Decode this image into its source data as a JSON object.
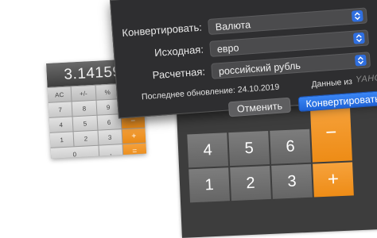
{
  "small_calculator": {
    "display": "3.1415926",
    "keys": [
      "AC",
      "+/-",
      "%",
      "÷",
      "7",
      "8",
      "9",
      "×",
      "4",
      "5",
      "6",
      "−",
      "1",
      "2",
      "3",
      "+",
      "0",
      "",
      ",",
      "="
    ],
    "key_types": [
      "fn",
      "fn",
      "fn",
      "op",
      "num",
      "num",
      "num",
      "op",
      "num",
      "num",
      "num",
      "op",
      "num",
      "num",
      "num",
      "op",
      "num",
      "num",
      "num",
      "op"
    ]
  },
  "big_calculator": {
    "keys": [
      "4",
      "5",
      "6",
      "−",
      "1",
      "2",
      "3",
      "+"
    ]
  },
  "dialog": {
    "convert_label": "Конвертировать:",
    "convert_value": "Валюта",
    "source_label": "Исходная:",
    "source_value": "евро",
    "target_label": "Расчетная:",
    "target_value": "российский рубль",
    "last_update": "Последнее обновление: 24.10.2019",
    "data_from": "Данные из",
    "provider": "YAHOO!",
    "cancel_label": "Отменить",
    "convert_button_label": "Конвертировать"
  },
  "colors": {
    "dialog_bg": "#2e2e30",
    "accent_blue": "#2f6fe0",
    "operator_orange": "#f39a2a"
  }
}
